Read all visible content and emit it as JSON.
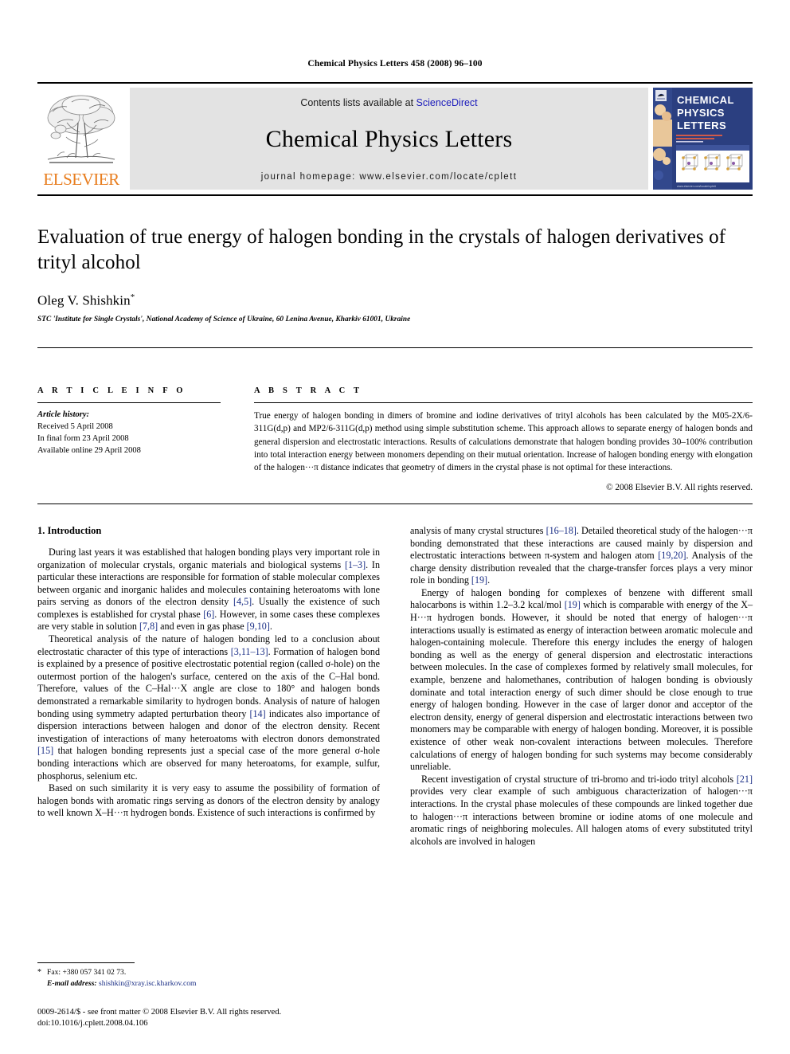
{
  "running_head": "Chemical Physics Letters 458 (2008) 96–100",
  "masthead": {
    "publisher_logo_name": "elsevier-tree-logo",
    "publisher_wordmark": "ELSEVIER",
    "contents_prefix": "Contents lists available at ",
    "contents_link": "ScienceDirect",
    "journal_title": "Chemical Physics Letters",
    "homepage_line": "journal homepage: www.elsevier.com/locate/cplett",
    "cover": {
      "line1": "CHEMICAL",
      "line2": "PHYSICS",
      "line3": "LETTERS",
      "bg_color": "#2b3f80",
      "text_color": "#ffffff",
      "footer_text": "www.elsevier.com/locate/cplett"
    }
  },
  "article": {
    "title": "Evaluation of true energy of halogen bonding in the crystals of halogen derivatives of trityl alcohol",
    "author": "Oleg V. Shishkin",
    "author_marker": "*",
    "affiliation": "STC 'Institute for Single Crystals', National Academy of Science of Ukraine, 60 Lenina Avenue, Kharkiv 61001, Ukraine"
  },
  "article_info": {
    "heading": "A R T I C L E   I N F O",
    "history_label": "Article history:",
    "history": [
      "Received 5 April 2008",
      "In final form 23 April 2008",
      "Available online 29 April 2008"
    ]
  },
  "abstract": {
    "heading": "A B S T R A C T",
    "body": "True energy of halogen bonding in dimers of bromine and iodine derivatives of trityl alcohols has been calculated by the M05-2X/6-311G(d,p) and MP2/6-311G(d,p) method using simple substitution scheme. This approach allows to separate energy of halogen bonds and general dispersion and electrostatic interactions. Results of calculations demonstrate that halogen bonding provides 30–100% contribution into total interaction energy between monomers depending on their mutual orientation. Increase of halogen bonding energy with elongation of the halogen···π distance indicates that geometry of dimers in the crystal phase is not optimal for these interactions.",
    "copyright": "© 2008 Elsevier B.V. All rights reserved."
  },
  "body": {
    "section_heading": "1. Introduction",
    "left_paragraphs": [
      "During last years it was established that halogen bonding plays very important role in organization of molecular crystals, organic materials and biological systems [1–3]. In particular these interactions are responsible for formation of stable molecular complexes between organic and inorganic halides and molecules containing heteroatoms with lone pairs serving as donors of the electron density [4,5]. Usually the existence of such complexes is established for crystal phase [6]. However, in some cases these complexes are very stable in solution [7,8] and even in gas phase [9,10].",
      "Theoretical analysis of the nature of halogen bonding led to a conclusion about electrostatic character of this type of interactions [3,11–13]. Formation of halogen bond is explained by a presence of positive electrostatic potential region (called σ-hole) on the outermost portion of the halogen's surface, centered on the axis of the C–Hal bond. Therefore, values of the C–Hal···X angle are close to 180° and halogen bonds demonstrated a remarkable similarity to hydrogen bonds. Analysis of nature of halogen bonding using symmetry adapted perturbation theory [14] indicates also importance of dispersion interactions between halogen and donor of the electron density. Recent investigation of interactions of many heteroatoms with electron donors demonstrated [15] that halogen bonding represents just a special case of the more general σ-hole bonding interactions which are observed for many heteroatoms, for example, sulfur, phosphorus, selenium etc.",
      "Based on such similarity it is very easy to assume the possibility of formation of halogen bonds with aromatic rings serving as donors of the electron density by analogy to well known X–H···π hydrogen bonds. Existence of such interactions is confirmed by"
    ],
    "right_paragraphs": [
      "analysis of many crystal structures [16–18]. Detailed theoretical study of the halogen···π bonding demonstrated that these interactions are caused mainly by dispersion and electrostatic interactions between π-system and halogen atom [19,20]. Analysis of the charge density distribution revealed that the charge-transfer forces plays a very minor role in bonding [19].",
      "Energy of halogen bonding for complexes of benzene with different small halocarbons is within 1.2–3.2 kcal/mol [19] which is comparable with energy of the X–H···π hydrogen bonds. However, it should be noted that energy of halogen···π interactions usually is estimated as energy of interaction between aromatic molecule and halogen-containing molecule. Therefore this energy includes the energy of halogen bonding as well as the energy of general dispersion and electrostatic interactions between molecules. In the case of complexes formed by relatively small molecules, for example, benzene and halomethanes, contribution of halogen bonding is obviously dominate and total interaction energy of such dimer should be close enough to true energy of halogen bonding. However in the case of larger donor and acceptor of the electron density, energy of general dispersion and electrostatic interactions between two monomers may be comparable with energy of halogen bonding. Moreover, it is possible existence of other weak non-covalent interactions between molecules. Therefore calculations of energy of halogen bonding for such systems may become considerably unreliable.",
      "Recent investigation of crystal structure of tri-bromo and tri-iodo trityl alcohols [21] provides very clear example of such ambiguous characterization of halogen···π interactions. In the crystal phase molecules of these compounds are linked together due to halogen···π interactions between bromine or iodine atoms of one molecule and aromatic rings of neighboring molecules. All halogen atoms of every substituted trityl alcohols are involved in halogen"
    ]
  },
  "footnote": {
    "marker": "*",
    "fax": "Fax: +380 057 341 02 73.",
    "email_label": "E-mail address:",
    "email": "shishkin@xray.isc.kharkov.com"
  },
  "imprint": {
    "line1": "0009-2614/$ - see front matter © 2008 Elsevier B.V. All rights reserved.",
    "line2": "doi:10.1016/j.cplett.2008.04.106"
  },
  "colors": {
    "link": "#1b1bbb",
    "reference": "#1b2f86",
    "elsevier_orange": "#E87D1E",
    "masthead_bg": "#e3e3e3",
    "cover_blue": "#2b3f80"
  }
}
